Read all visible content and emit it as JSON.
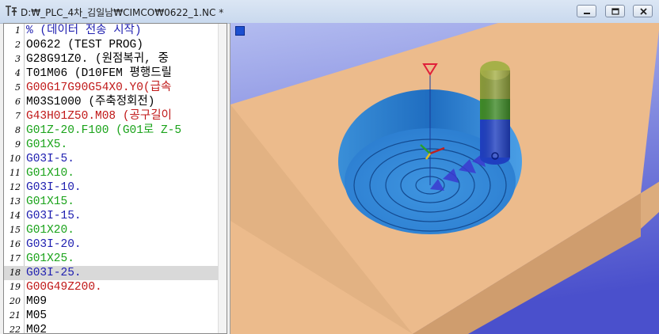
{
  "window": {
    "title": "D:₩_PLC_4차_김일남₩CIMCO₩0622_1.NC *",
    "buttons": [
      "minimize",
      "restore",
      "close"
    ]
  },
  "editor": {
    "selected_line": 18,
    "lines": [
      {
        "num": "1",
        "text": "% (데이터 전송 시작)",
        "color": "#1f1fb0"
      },
      {
        "num": "2",
        "text": "O0622 (TEST PROG)",
        "color": "#000000"
      },
      {
        "num": "3",
        "text": "G28G91Z0. (원점복귀, 중",
        "color": "#000000"
      },
      {
        "num": "4",
        "text": "T01M06 (D10FEM 평행드릴",
        "color": "#000000"
      },
      {
        "num": "5",
        "text": "G00G17G90G54X0.Y0(급속 ",
        "color": "#c01818"
      },
      {
        "num": "6",
        "text": "M03S1000 (주축정회전)",
        "color": "#000000"
      },
      {
        "num": "7",
        "text": "G43H01Z50.M08 (공구길이",
        "color": "#c01818"
      },
      {
        "num": "8",
        "text": "G01Z-20.F100 (G01로 Z-5",
        "color": "#1aa31a"
      },
      {
        "num": "9",
        "text": "G01X5.",
        "color": "#1aa31a"
      },
      {
        "num": "10",
        "text": "G03I-5.",
        "color": "#1f1fb0"
      },
      {
        "num": "11",
        "text": "G01X10.",
        "color": "#1aa31a"
      },
      {
        "num": "12",
        "text": "G03I-10.",
        "color": "#1f1fb0"
      },
      {
        "num": "13",
        "text": "G01X15.",
        "color": "#1aa31a"
      },
      {
        "num": "14",
        "text": "G03I-15.",
        "color": "#1f1fb0"
      },
      {
        "num": "15",
        "text": "G01X20.",
        "color": "#1aa31a"
      },
      {
        "num": "16",
        "text": "G03I-20.",
        "color": "#1f1fb0"
      },
      {
        "num": "17",
        "text": "G01X25.",
        "color": "#1aa31a"
      },
      {
        "num": "18",
        "text": "G03I-25.",
        "color": "#1f1fb0"
      },
      {
        "num": "19",
        "text": "G00G49Z200.",
        "color": "#c01818"
      },
      {
        "num": "20",
        "text": "M09",
        "color": "#000000"
      },
      {
        "num": "21",
        "text": "M05",
        "color": "#000000"
      },
      {
        "num": "22",
        "text": "M02",
        "color": "#000000"
      }
    ]
  },
  "viewport": {
    "colors": {
      "background_top": "#aeb7ee",
      "background_bottom": "#4d53cf",
      "stock_top": "#ecbb8c",
      "stock_side": "#dcac7d",
      "pocket": "#2f86d6",
      "toolpath": "#134a90",
      "tool_top": "#8a9a3a",
      "tool_mid": "#3f8a28",
      "tool_bottom": "#1f3fc0"
    }
  }
}
